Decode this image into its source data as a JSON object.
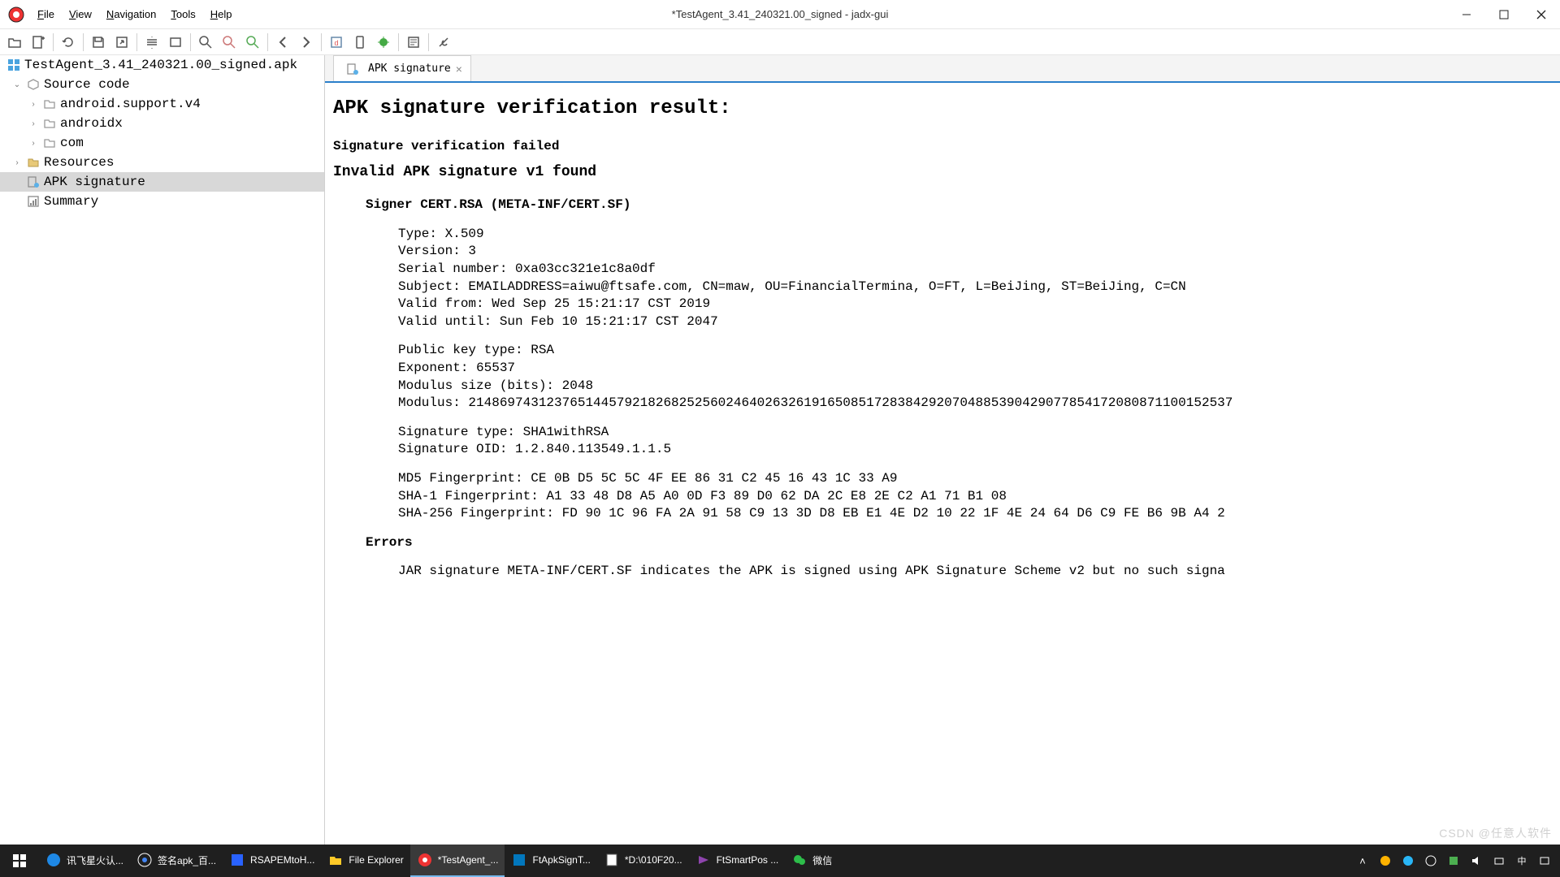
{
  "window": {
    "title": "*TestAgent_3.41_240321.00_signed - jadx-gui"
  },
  "menu": {
    "file": "File",
    "view": "View",
    "navigation": "Navigation",
    "tools": "Tools",
    "help": "Help"
  },
  "tree": {
    "root": "TestAgent_3.41_240321.00_signed.apk",
    "source_code": "Source code",
    "android_support": "android.support.v4",
    "androidx": "androidx",
    "com": "com",
    "resources": "Resources",
    "apk_signature": "APK signature",
    "summary": "Summary"
  },
  "tab": {
    "label": "APK signature"
  },
  "sig": {
    "heading": "APK signature verification result:",
    "failed": "Signature verification failed",
    "invalid": "Invalid APK signature v1 found",
    "signer": "Signer CERT.RSA (META-INF/CERT.SF)",
    "type": "Type: X.509",
    "version": "Version: 3",
    "serial": "Serial number: 0xa03cc321e1c8a0df",
    "subject": "Subject: EMAILADDRESS=aiwu@ftsafe.com, CN=maw, OU=FinancialTermina, O=FT, L=BeiJing, ST=BeiJing, C=CN",
    "valid_from": "Valid from: Wed Sep 25 15:21:17 CST 2019",
    "valid_until": "Valid until: Sun Feb 10 15:21:17 CST 2047",
    "pk_type": "Public key type: RSA",
    "exponent": "Exponent: 65537",
    "mod_size": "Modulus size (bits): 2048",
    "modulus": "Modulus: 21486974312376514457921826825256024640263261916508517283842920704885390429077854172080871100152537",
    "sig_type": "Signature type: SHA1withRSA",
    "sig_oid": "Signature OID: 1.2.840.113549.1.1.5",
    "md5": "MD5 Fingerprint: CE 0B D5 5C 5C 4F EE 86 31 C2 45 16 43 1C 33 A9",
    "sha1": "SHA-1 Fingerprint: A1 33 48 D8 A5 A0 0D F3 89 D0 62 DA 2C E8 2E C2 A1 71 B1 08",
    "sha256": "SHA-256 Fingerprint: FD 90 1C 96 FA 2A 91 58 C9 13 3D D8 EB E1 4E D2 10 22 1F 4E 24 64 D6 C9 FE B6 9B A4 2",
    "errors_label": "Errors",
    "error1": "JAR signature META-INF/CERT.SF indicates the APK is signed using APK Signature Scheme v2 but no such signa"
  },
  "taskbar": {
    "items": [
      "讯飞星火认...",
      "签名apk_百...",
      "RSAPEMtoH...",
      "File Explorer",
      "*TestAgent_...",
      "FtApkSignT...",
      "*D:\\010F20...",
      "FtSmartPos ...",
      "微信"
    ],
    "time": "",
    "watermark": "CSDN @任意人软件"
  }
}
